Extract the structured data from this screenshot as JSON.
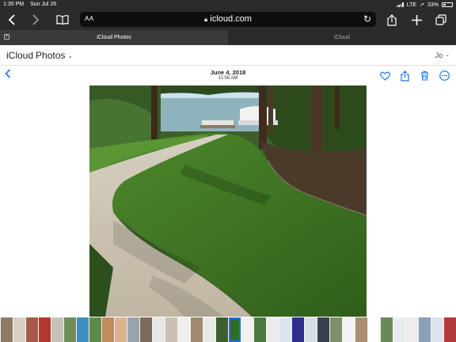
{
  "status_bar": {
    "time": "1:35 PM",
    "date": "Sun Jul 26",
    "network": "LTE",
    "battery": "33%"
  },
  "browser": {
    "reader_label": "AA",
    "url": "icloud.com",
    "tabs": [
      {
        "label": "iCloud Photos"
      },
      {
        "label": "iCloud"
      }
    ]
  },
  "app": {
    "brand": "iCloud",
    "section": "Photos",
    "user": "Jo"
  },
  "photo": {
    "date": "June 4, 2018",
    "time": "11:56 AM"
  },
  "colors": {
    "accent": "#1a73e8",
    "chrome": "#2b2b2b"
  },
  "filmstrip": {
    "thumbs": [
      "#8c7a66",
      "#d8d0c6",
      "#a45b4a",
      "#b3372d",
      "#c8c1b8",
      "#6e8f5a",
      "#3e8fbf",
      "#5f8a4a",
      "#c48a5a",
      "#d9b58c",
      "#9aa3ad",
      "#7a6b5a",
      "#e6e6e6",
      "#c9c1b0",
      "#efefef",
      "#9e8a6c",
      "#e8e8e8",
      "#3b5f2f",
      "#2f6d2a",
      "#f0f0f0",
      "#4a7a3c",
      "#ececec",
      "#dbe5ef",
      "#2d2f8a",
      "#d6dee6",
      "#3a3f4a",
      "#7d8f6a",
      "#f2f2f2",
      "#a88e72",
      "#ffffff",
      "#6b8a5a",
      "#e6ecf2",
      "#ededed",
      "#8aa0b8",
      "#dde3ea",
      "#b23b3b",
      "#d9e2ec",
      "#c9d4e0",
      "#eeeeee",
      "#f4f4f4"
    ],
    "selected_index": 18
  }
}
